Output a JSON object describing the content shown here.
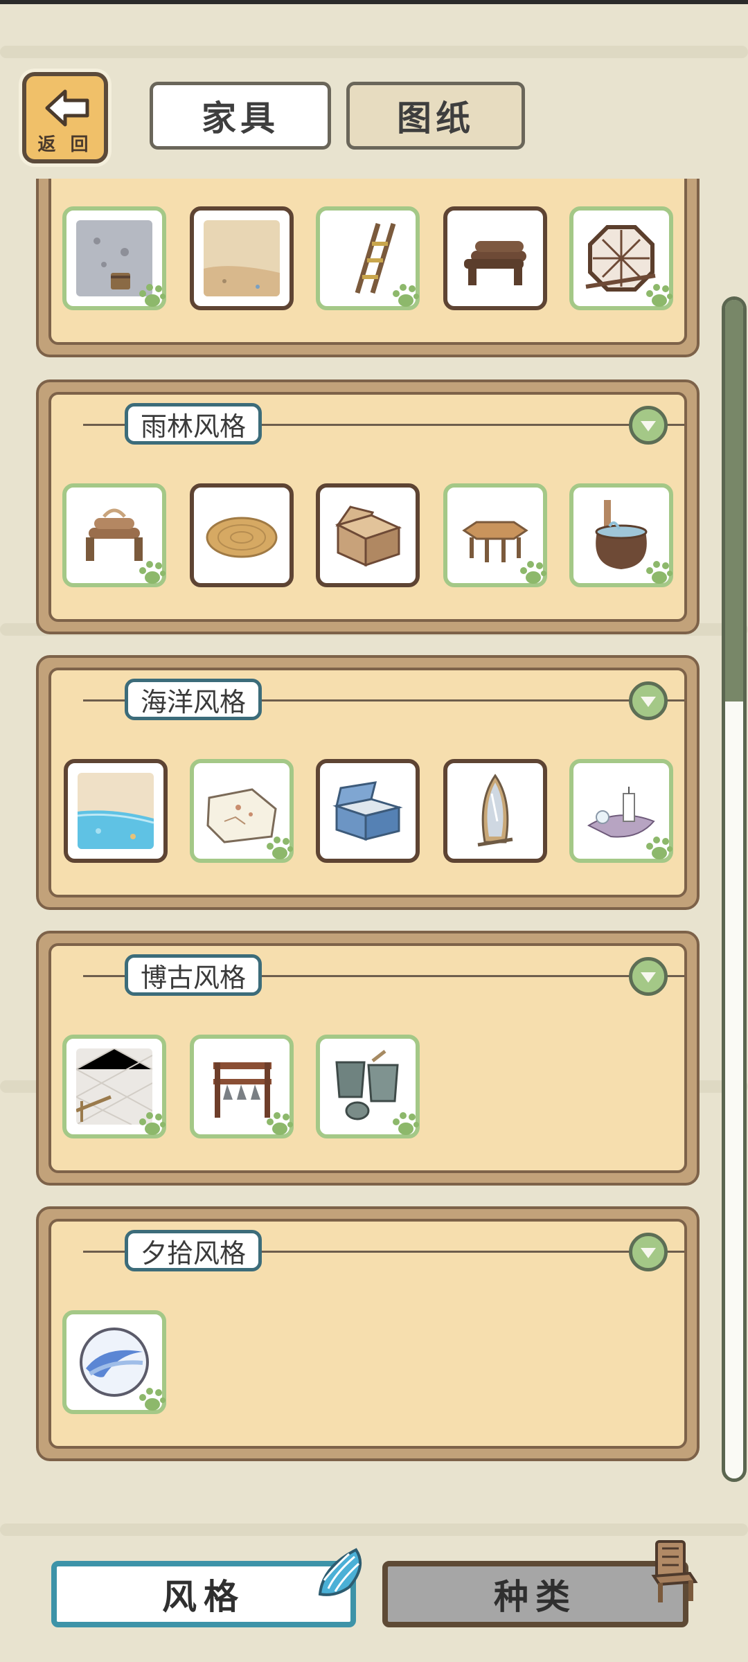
{
  "header": {
    "back_label": "返 回",
    "tabs": [
      {
        "label": "家具",
        "active": true
      },
      {
        "label": "图纸",
        "active": false
      }
    ]
  },
  "sections": [
    {
      "title": "",
      "items": [
        {
          "name": "stone wall with bucket",
          "owned": true
        },
        {
          "name": "sand floor",
          "owned": false
        },
        {
          "name": "wooden ladder",
          "owned": true
        },
        {
          "name": "log bench",
          "owned": false
        },
        {
          "name": "octagon window frame",
          "owned": true
        }
      ]
    },
    {
      "title": "雨林风格",
      "items": [
        {
          "name": "rope log stool",
          "owned": true
        },
        {
          "name": "woven round mat",
          "owned": false
        },
        {
          "name": "wooden box",
          "owned": false
        },
        {
          "name": "octagonal table",
          "owned": true
        },
        {
          "name": "clay water jar",
          "owned": true
        }
      ]
    },
    {
      "title": "海洋风格",
      "items": [
        {
          "name": "beach water floor",
          "owned": false
        },
        {
          "name": "treasure map",
          "owned": true
        },
        {
          "name": "blue treasure chest",
          "owned": false
        },
        {
          "name": "surfboard mirror",
          "owned": false
        },
        {
          "name": "shell candle",
          "owned": true
        }
      ]
    },
    {
      "title": "博古风格",
      "items": [
        {
          "name": "tiled floor",
          "owned": true
        },
        {
          "name": "ancient chime rack",
          "owned": true
        },
        {
          "name": "bronze vessels",
          "owned": true
        }
      ]
    },
    {
      "title": "夕拾风格",
      "items": [
        {
          "name": "glass marble",
          "owned": true
        }
      ]
    }
  ],
  "bottom_tabs": [
    {
      "label": "风格",
      "active": true
    },
    {
      "label": "种类",
      "active": false
    }
  ],
  "colors": {
    "background": "#e8e3cf",
    "panel": "#f6deae",
    "owned_border": "#a4c887",
    "active_tab_border": "#3d93a8"
  }
}
